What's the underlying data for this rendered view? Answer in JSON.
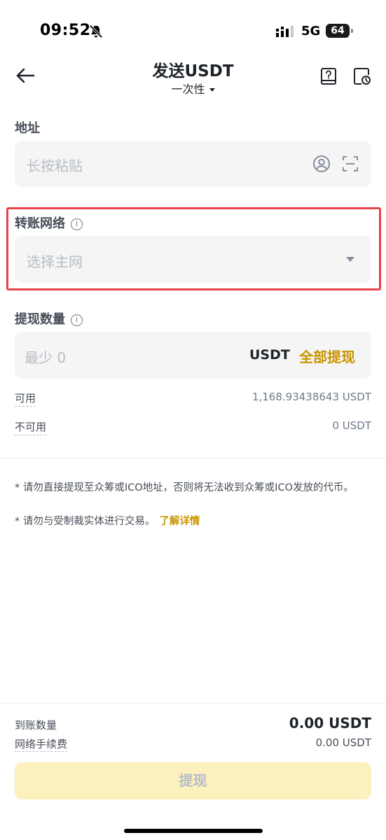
{
  "status_bar": {
    "time": "09:52",
    "network": "5G",
    "battery": "64"
  },
  "header": {
    "title": "发送USDT",
    "mode": "一次性"
  },
  "address": {
    "label": "地址",
    "placeholder": "长按粘贴"
  },
  "network": {
    "label": "转账网络",
    "placeholder": "选择主网"
  },
  "amount": {
    "label": "提现数量",
    "placeholder": "最少 0",
    "unit": "USDT",
    "max_label": "全部提现"
  },
  "balances": {
    "available_label": "可用",
    "available_value": "1,168.93438643 USDT",
    "unavailable_label": "不可用",
    "unavailable_value": "0 USDT"
  },
  "notices": {
    "line1": "* 请勿直接提现至众筹或ICO地址，否则将无法收到众筹或ICO发放的代币。",
    "line2": "* 请勿与受制裁实体进行交易。",
    "link": "了解详情"
  },
  "footer": {
    "receive_label": "到账数量",
    "receive_value": "0.00 USDT",
    "fee_label": "网络手续费",
    "fee_value": "0.00 USDT",
    "submit_label": "提现"
  },
  "colors": {
    "accent": "#c99400",
    "highlight_border": "#e8434a",
    "button_disabled_bg": "#fcf0bd"
  }
}
